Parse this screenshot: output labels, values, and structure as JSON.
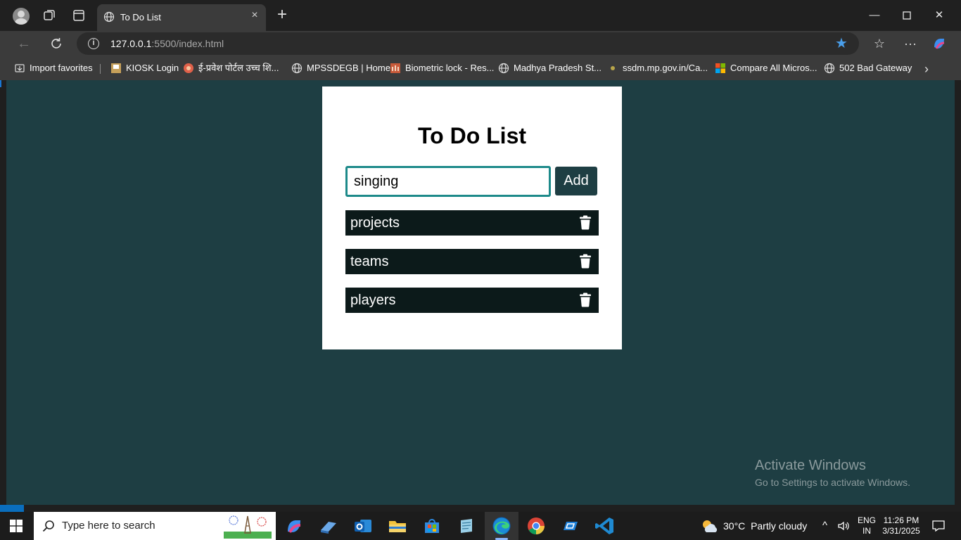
{
  "browser": {
    "tab_title": "To Do List",
    "url_host": "127.0.0.1",
    "url_rest": ":5500/index.html",
    "bookmarks": [
      {
        "label": "Import favorites",
        "icon": "import-icon"
      },
      {
        "label": "KIOSK Login",
        "icon": "kiosk-icon"
      },
      {
        "label": "ई-प्रवेश पोर्टल उच्च शि...",
        "icon": "eportal-icon"
      },
      {
        "label": "MPSSDEGB | Home",
        "icon": "globe-icon"
      },
      {
        "label": "Biometric lock - Res...",
        "icon": "biometric-icon"
      },
      {
        "label": "Madhya Pradesh St...",
        "icon": "globe-icon"
      },
      {
        "label": "ssdm.mp.gov.in/Ca...",
        "icon": "dot-icon"
      },
      {
        "label": "Compare All Micros...",
        "icon": "microsoft-icon"
      },
      {
        "label": "502 Bad Gateway",
        "icon": "globe-icon"
      }
    ]
  },
  "app": {
    "title": "To Do List",
    "input_value": "singing",
    "add_label": "Add",
    "items": [
      "projects",
      "teams",
      "players"
    ]
  },
  "watermark": {
    "line1": "Activate Windows",
    "line2": "Go to Settings to activate Windows."
  },
  "taskbar": {
    "search_placeholder": "Type here to search",
    "temperature": "30°C",
    "weather": "Partly cloudy",
    "lang1": "ENG",
    "lang2": "IN",
    "time": "11:26 PM",
    "date": "3/31/2025"
  },
  "colors": {
    "page_bg": "#1e3e43",
    "item_bg": "#0c1a1a",
    "input_border": "#1d8a8a",
    "accent": "#4a9fea"
  }
}
